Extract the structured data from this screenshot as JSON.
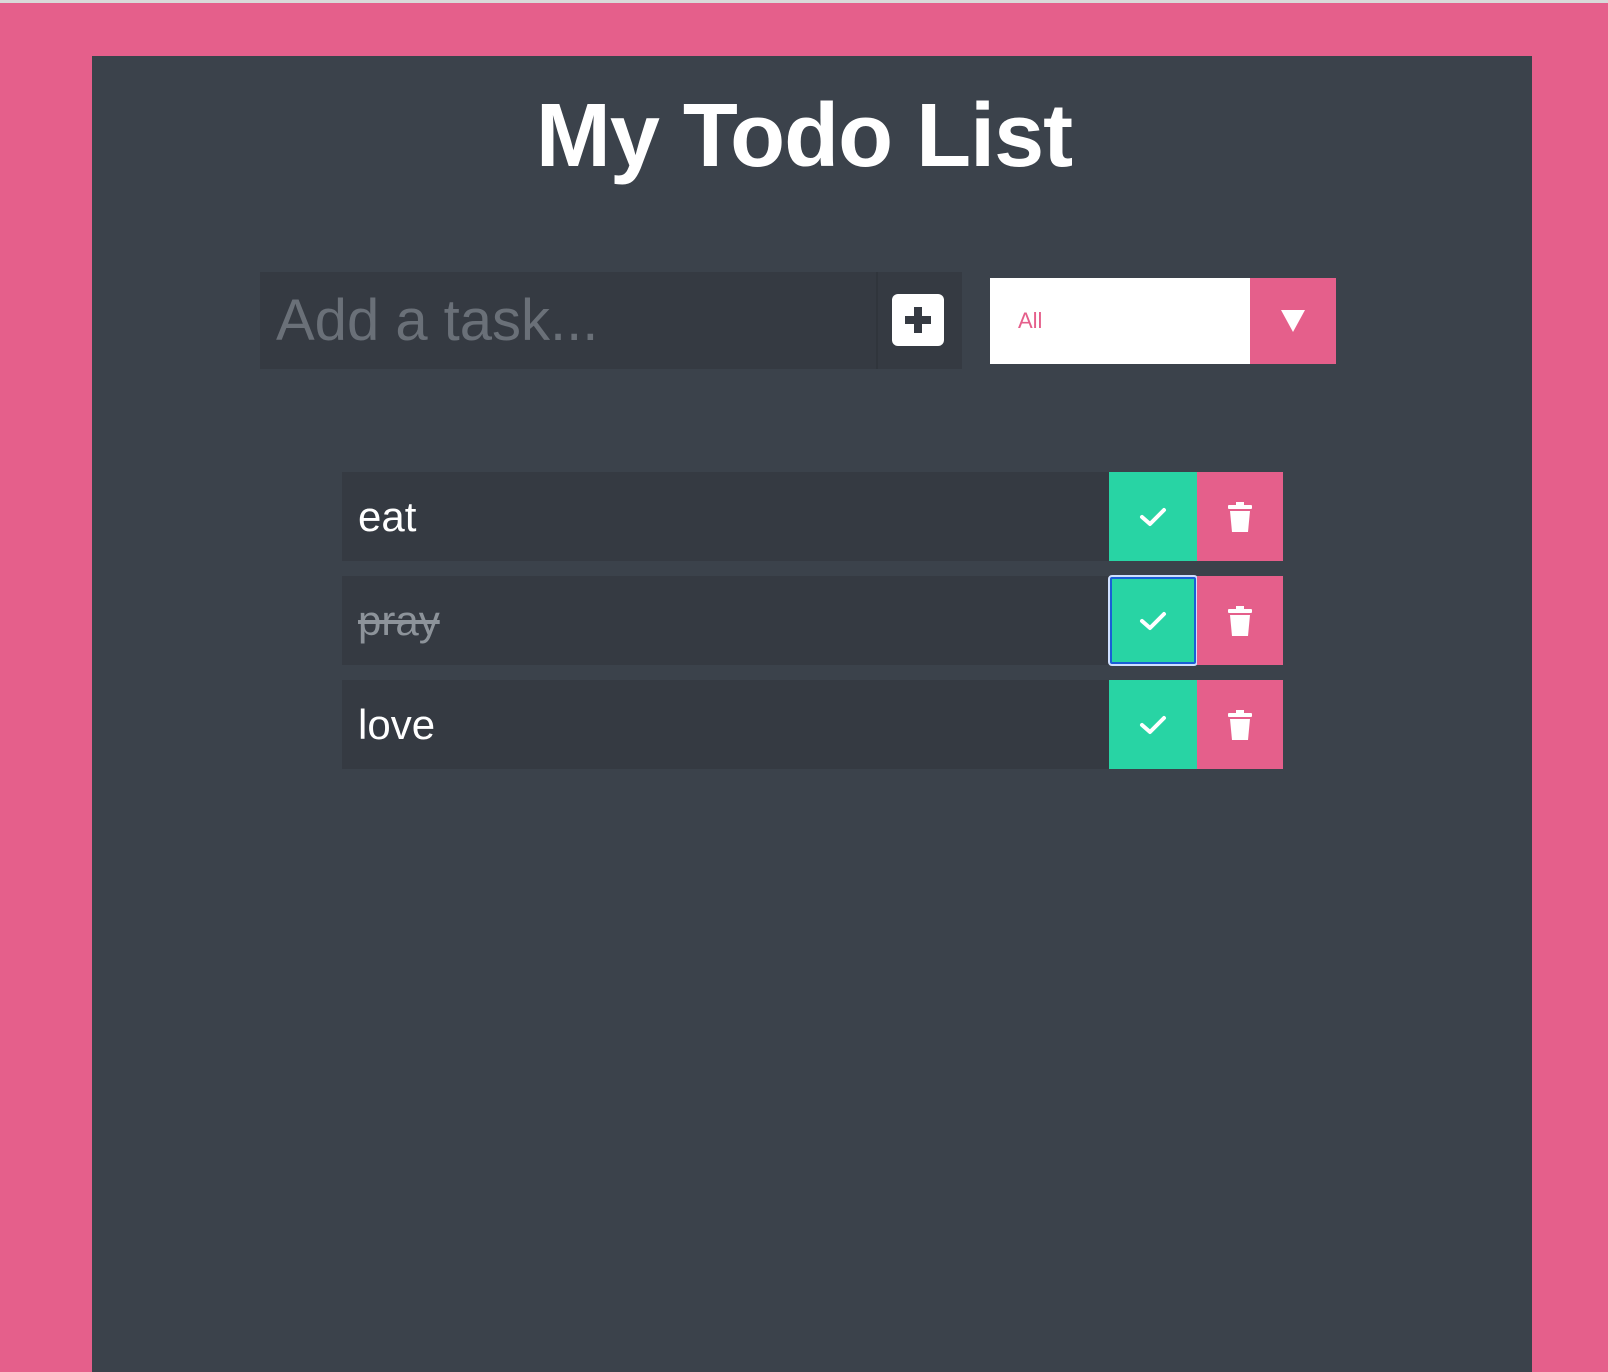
{
  "header": {
    "title": "My Todo List"
  },
  "add_task": {
    "placeholder": "Add a task...",
    "value": "",
    "button_icon": "plus-square-icon"
  },
  "filter": {
    "selected": "All",
    "arrow_icon": "triangle-down-icon"
  },
  "todos": [
    {
      "text": "eat",
      "completed": false
    },
    {
      "text": "pray",
      "completed": true
    },
    {
      "text": "love",
      "completed": false
    }
  ],
  "colors": {
    "background": "#e55f8b",
    "panel": "#3b424b",
    "item": "#353a42",
    "check": "#28d4a4",
    "trash": "#e55f8b",
    "focus_ring": "#1a5fd6"
  }
}
